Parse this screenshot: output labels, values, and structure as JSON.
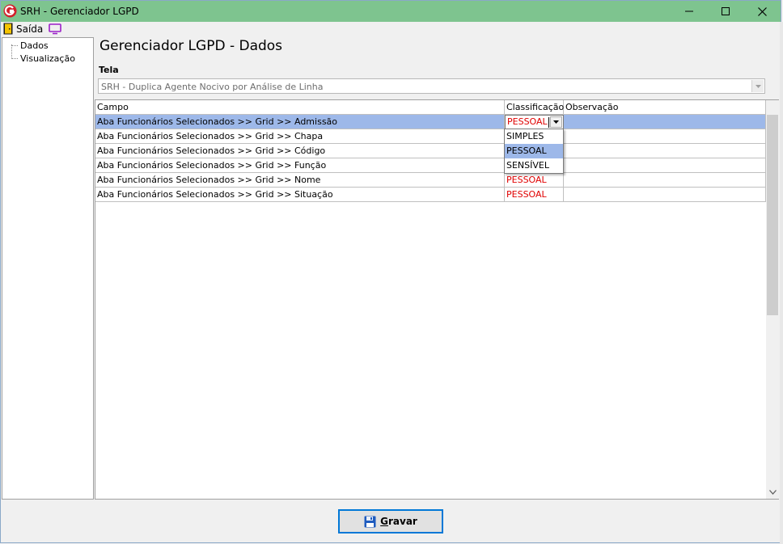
{
  "window": {
    "title": "SRH - Gerenciador LGPD"
  },
  "menu": {
    "exit_label": "Saída"
  },
  "tree": {
    "items": [
      {
        "label": "Dados"
      },
      {
        "label": "Visualização"
      }
    ]
  },
  "page": {
    "title": "Gerenciador LGPD - Dados",
    "tela_label": "Tela",
    "tela_value": "SRH - Duplica Agente Nocivo por Análise de Linha"
  },
  "grid": {
    "columns": [
      "Campo",
      "Classificação",
      "Observação"
    ],
    "rows": [
      {
        "campo": "Aba Funcionários Selecionados >> Grid >> Admissão",
        "classificacao": "PESSOAL",
        "observacao": ""
      },
      {
        "campo": "Aba Funcionários Selecionados >> Grid >> Chapa",
        "classificacao": "",
        "observacao": ""
      },
      {
        "campo": "Aba Funcionários Selecionados >> Grid >> Código",
        "classificacao": "",
        "observacao": ""
      },
      {
        "campo": "Aba Funcionários Selecionados >> Grid >> Função",
        "classificacao": "",
        "observacao": ""
      },
      {
        "campo": "Aba Funcionários Selecionados >> Grid >> Nome",
        "classificacao": "PESSOAL",
        "observacao": ""
      },
      {
        "campo": "Aba Funcionários Selecionados >> Grid >> Situação",
        "classificacao": "PESSOAL",
        "observacao": ""
      }
    ],
    "dropdown_options": [
      "SIMPLES",
      "PESSOAL",
      "SENSÍVEL"
    ],
    "dropdown_selected": "PESSOAL"
  },
  "actions": {
    "save_label_underlined": "G",
    "save_label_rest": "ravar"
  },
  "colors": {
    "titlebar": "#7ec48f",
    "selection": "#9db8e9",
    "classification_text": "#e00000"
  }
}
